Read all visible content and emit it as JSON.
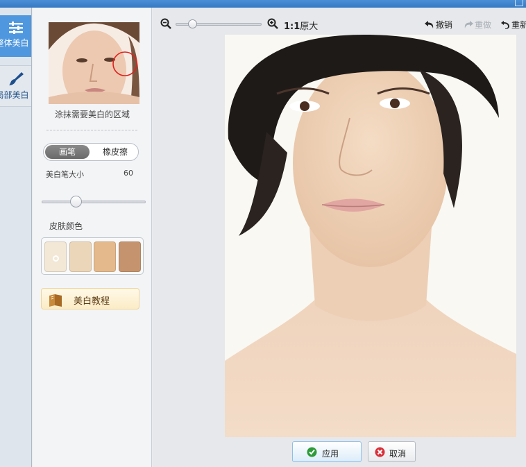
{
  "rail": {
    "tabs": [
      {
        "label": "整体美白",
        "icon": "sliders-icon",
        "active": true
      },
      {
        "label": "局部美白",
        "icon": "brush-icon",
        "active": false
      }
    ]
  },
  "panel": {
    "hint": "涂抹需要美白的区域",
    "mode": {
      "brush": "画笔",
      "eraser": "橡皮擦",
      "selected": "brush"
    },
    "brush_size": {
      "label": "美白笔大小",
      "value": "60",
      "level": 0.3
    },
    "skin": {
      "label": "皮肤颜色",
      "swatches": [
        "#f3e7d6",
        "#ecd6b9",
        "#e4b98c",
        "#c5946e"
      ],
      "selected_index": 0
    },
    "tutorial_label": "美白教程"
  },
  "toolbar": {
    "zoom_level": 0.15,
    "ratio_bold": "1:1",
    "ratio_text": "原大",
    "undo": "撤销",
    "redo": "重做",
    "reset": "重新"
  },
  "actions": {
    "apply": "应用",
    "cancel": "取消"
  },
  "colors": {
    "accent": "#4f97de",
    "apply_border": "#8fbfe7",
    "brush_marker": "#e0201c"
  }
}
